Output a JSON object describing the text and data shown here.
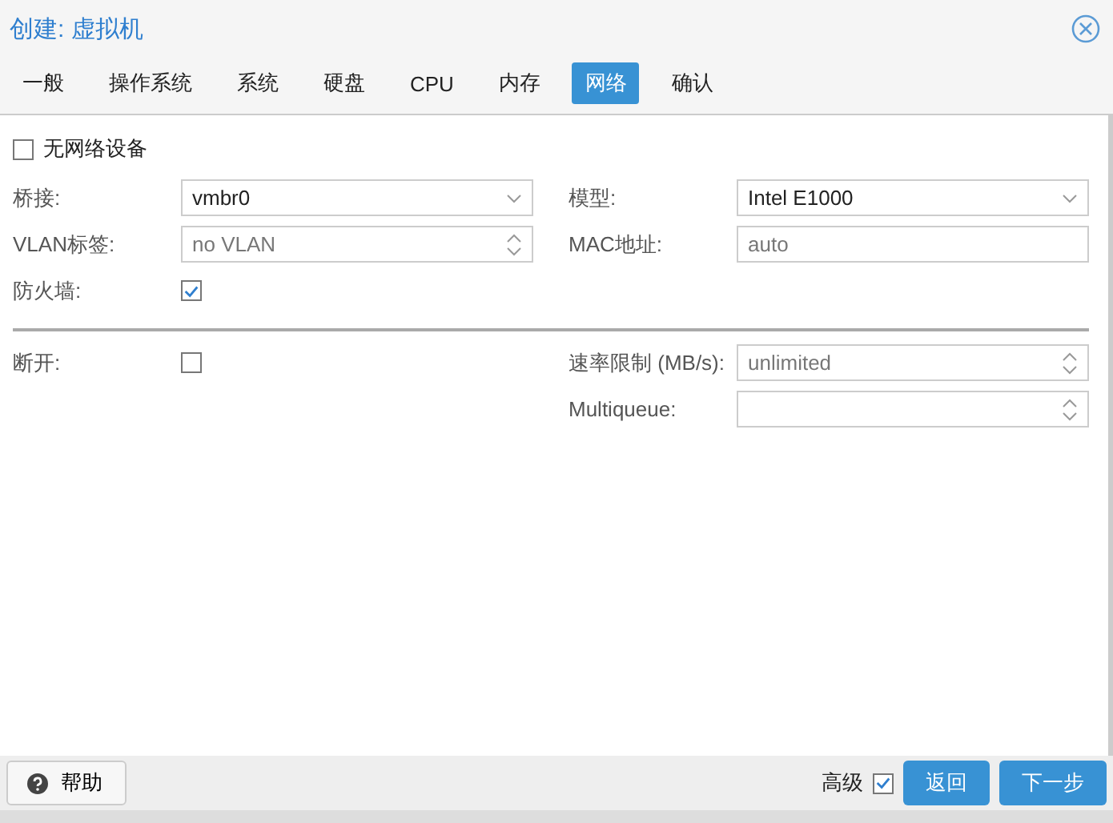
{
  "window": {
    "title": "创建: 虚拟机"
  },
  "tabs": [
    {
      "label": "一般",
      "selected": false
    },
    {
      "label": "操作系统",
      "selected": false
    },
    {
      "label": "系统",
      "selected": false
    },
    {
      "label": "硬盘",
      "selected": false
    },
    {
      "label": "CPU",
      "selected": false
    },
    {
      "label": "内存",
      "selected": false
    },
    {
      "label": "网络",
      "selected": true
    },
    {
      "label": "确认",
      "selected": false
    }
  ],
  "no_network_device": {
    "label": "无网络设备",
    "checked": false
  },
  "left_fields": [
    {
      "kind": "select",
      "label": "桥接:",
      "value": "vmbr0"
    },
    {
      "kind": "spinner",
      "label": "VLAN标签:",
      "placeholder": "no VLAN"
    },
    {
      "kind": "checkbox",
      "label": "防火墙:",
      "checked": true
    }
  ],
  "right_fields": [
    {
      "kind": "select",
      "label": "模型:",
      "value": "Intel E1000"
    },
    {
      "kind": "text",
      "label": "MAC地址:",
      "placeholder": "auto"
    }
  ],
  "advanced_left": [
    {
      "kind": "checkbox",
      "label": "断开:",
      "checked": false
    }
  ],
  "advanced_right": [
    {
      "kind": "spinner",
      "label": "速率限制 (MB/s):",
      "placeholder": "unlimited"
    },
    {
      "kind": "spinner",
      "label": "Multiqueue:"
    }
  ],
  "footer": {
    "help": "帮助",
    "advanced": {
      "label": "高级",
      "checked": true
    },
    "buttons": [
      "返回",
      "下一步"
    ]
  }
}
